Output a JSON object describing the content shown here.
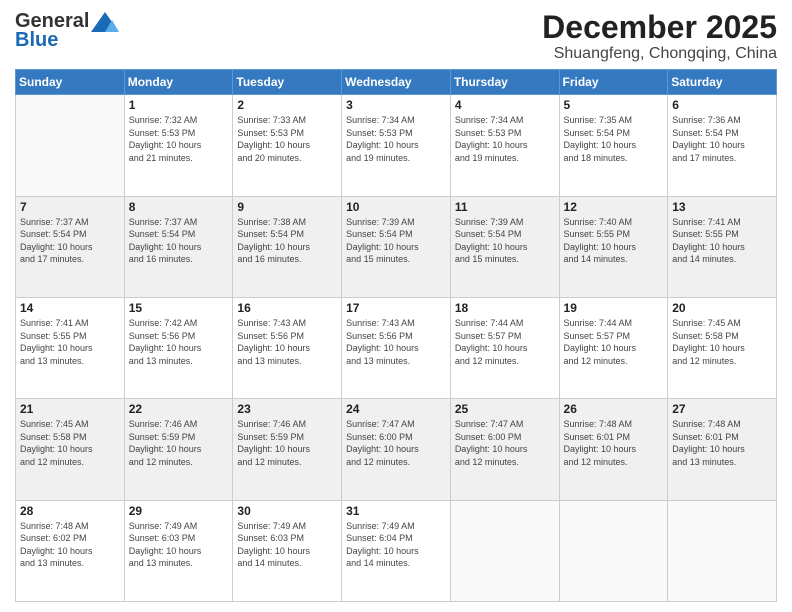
{
  "header": {
    "logo_general": "General",
    "logo_blue": "Blue",
    "month_title": "December 2025",
    "location": "Shuangfeng, Chongqing, China"
  },
  "days_of_week": [
    "Sunday",
    "Monday",
    "Tuesday",
    "Wednesday",
    "Thursday",
    "Friday",
    "Saturday"
  ],
  "weeks": [
    [
      {
        "day": "",
        "info": ""
      },
      {
        "day": "1",
        "info": "Sunrise: 7:32 AM\nSunset: 5:53 PM\nDaylight: 10 hours\nand 21 minutes."
      },
      {
        "day": "2",
        "info": "Sunrise: 7:33 AM\nSunset: 5:53 PM\nDaylight: 10 hours\nand 20 minutes."
      },
      {
        "day": "3",
        "info": "Sunrise: 7:34 AM\nSunset: 5:53 PM\nDaylight: 10 hours\nand 19 minutes."
      },
      {
        "day": "4",
        "info": "Sunrise: 7:34 AM\nSunset: 5:53 PM\nDaylight: 10 hours\nand 19 minutes."
      },
      {
        "day": "5",
        "info": "Sunrise: 7:35 AM\nSunset: 5:54 PM\nDaylight: 10 hours\nand 18 minutes."
      },
      {
        "day": "6",
        "info": "Sunrise: 7:36 AM\nSunset: 5:54 PM\nDaylight: 10 hours\nand 17 minutes."
      }
    ],
    [
      {
        "day": "7",
        "info": "Sunrise: 7:37 AM\nSunset: 5:54 PM\nDaylight: 10 hours\nand 17 minutes."
      },
      {
        "day": "8",
        "info": "Sunrise: 7:37 AM\nSunset: 5:54 PM\nDaylight: 10 hours\nand 16 minutes."
      },
      {
        "day": "9",
        "info": "Sunrise: 7:38 AM\nSunset: 5:54 PM\nDaylight: 10 hours\nand 16 minutes."
      },
      {
        "day": "10",
        "info": "Sunrise: 7:39 AM\nSunset: 5:54 PM\nDaylight: 10 hours\nand 15 minutes."
      },
      {
        "day": "11",
        "info": "Sunrise: 7:39 AM\nSunset: 5:54 PM\nDaylight: 10 hours\nand 15 minutes."
      },
      {
        "day": "12",
        "info": "Sunrise: 7:40 AM\nSunset: 5:55 PM\nDaylight: 10 hours\nand 14 minutes."
      },
      {
        "day": "13",
        "info": "Sunrise: 7:41 AM\nSunset: 5:55 PM\nDaylight: 10 hours\nand 14 minutes."
      }
    ],
    [
      {
        "day": "14",
        "info": "Sunrise: 7:41 AM\nSunset: 5:55 PM\nDaylight: 10 hours\nand 13 minutes."
      },
      {
        "day": "15",
        "info": "Sunrise: 7:42 AM\nSunset: 5:56 PM\nDaylight: 10 hours\nand 13 minutes."
      },
      {
        "day": "16",
        "info": "Sunrise: 7:43 AM\nSunset: 5:56 PM\nDaylight: 10 hours\nand 13 minutes."
      },
      {
        "day": "17",
        "info": "Sunrise: 7:43 AM\nSunset: 5:56 PM\nDaylight: 10 hours\nand 13 minutes."
      },
      {
        "day": "18",
        "info": "Sunrise: 7:44 AM\nSunset: 5:57 PM\nDaylight: 10 hours\nand 12 minutes."
      },
      {
        "day": "19",
        "info": "Sunrise: 7:44 AM\nSunset: 5:57 PM\nDaylight: 10 hours\nand 12 minutes."
      },
      {
        "day": "20",
        "info": "Sunrise: 7:45 AM\nSunset: 5:58 PM\nDaylight: 10 hours\nand 12 minutes."
      }
    ],
    [
      {
        "day": "21",
        "info": "Sunrise: 7:45 AM\nSunset: 5:58 PM\nDaylight: 10 hours\nand 12 minutes."
      },
      {
        "day": "22",
        "info": "Sunrise: 7:46 AM\nSunset: 5:59 PM\nDaylight: 10 hours\nand 12 minutes."
      },
      {
        "day": "23",
        "info": "Sunrise: 7:46 AM\nSunset: 5:59 PM\nDaylight: 10 hours\nand 12 minutes."
      },
      {
        "day": "24",
        "info": "Sunrise: 7:47 AM\nSunset: 6:00 PM\nDaylight: 10 hours\nand 12 minutes."
      },
      {
        "day": "25",
        "info": "Sunrise: 7:47 AM\nSunset: 6:00 PM\nDaylight: 10 hours\nand 12 minutes."
      },
      {
        "day": "26",
        "info": "Sunrise: 7:48 AM\nSunset: 6:01 PM\nDaylight: 10 hours\nand 12 minutes."
      },
      {
        "day": "27",
        "info": "Sunrise: 7:48 AM\nSunset: 6:01 PM\nDaylight: 10 hours\nand 13 minutes."
      }
    ],
    [
      {
        "day": "28",
        "info": "Sunrise: 7:48 AM\nSunset: 6:02 PM\nDaylight: 10 hours\nand 13 minutes."
      },
      {
        "day": "29",
        "info": "Sunrise: 7:49 AM\nSunset: 6:03 PM\nDaylight: 10 hours\nand 13 minutes."
      },
      {
        "day": "30",
        "info": "Sunrise: 7:49 AM\nSunset: 6:03 PM\nDaylight: 10 hours\nand 14 minutes."
      },
      {
        "day": "31",
        "info": "Sunrise: 7:49 AM\nSunset: 6:04 PM\nDaylight: 10 hours\nand 14 minutes."
      },
      {
        "day": "",
        "info": ""
      },
      {
        "day": "",
        "info": ""
      },
      {
        "day": "",
        "info": ""
      }
    ]
  ]
}
